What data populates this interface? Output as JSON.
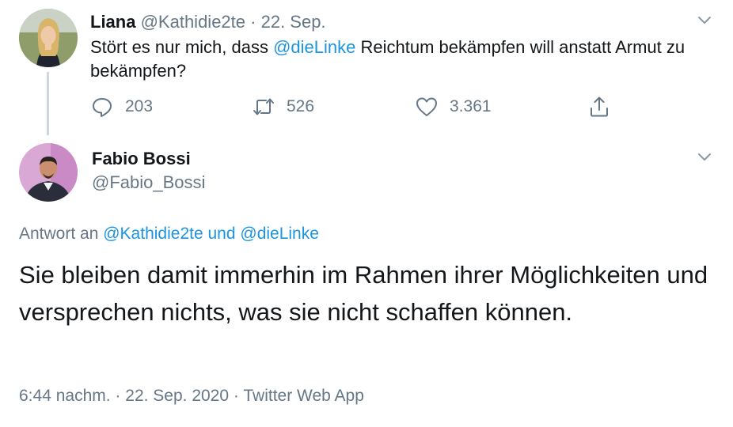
{
  "original_tweet": {
    "author_name": "Liana",
    "handle": "@Kathidie2te",
    "separator": "·",
    "date": "22. Sep.",
    "text_before": "Stört es nur mich, dass ",
    "mention": "@dieLinke",
    "text_after": " Reichtum bekämpfen will anstatt Armut zu bekämpfen?",
    "replies": "203",
    "retweets": "526",
    "likes": "3.361"
  },
  "reply_tweet": {
    "author_name": "Fabio Bossi",
    "handle": "@Fabio_Bossi",
    "reply_label": "Antwort an",
    "reply_mention_1": "@Kathidie2te",
    "reply_and": "und",
    "reply_mention_2": "@dieLinke",
    "text": "Sie bleiben damit immerhin im Rahmen ihrer Möglichkeiten und versprechen nichts, was sie nicht schaffen können.",
    "time": "6:44 nachm.",
    "sep1": "·",
    "date": "22. Sep. 2020",
    "sep2": "·",
    "source": "Twitter Web App"
  },
  "colors": {
    "link": "#1b95e0",
    "muted": "#657786",
    "text": "#14171a",
    "thread_line": "#ccd6dd"
  },
  "icons": {
    "reply": "reply-icon",
    "retweet": "retweet-icon",
    "like": "heart-icon",
    "share": "share-icon",
    "menu": "chevron-down-icon"
  }
}
